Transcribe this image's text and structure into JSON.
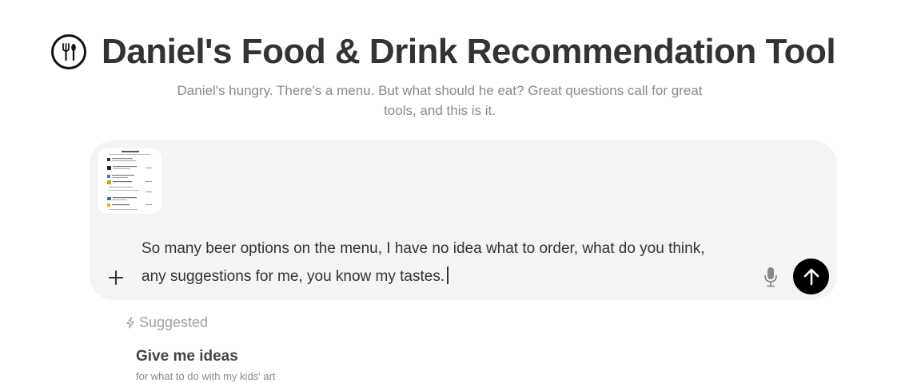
{
  "header": {
    "logo_icon": "fork-spoon-icon",
    "title": "Daniel's Food & Drink Recommendation Tool",
    "subtitle_line1": "Daniel's hungry. There's a menu. But what should he eat? Great questions call for great",
    "subtitle_line2": "tools, and this is it."
  },
  "composer": {
    "attachment_icon": "image-thumbnail",
    "prompt_line1": "So many beer options on the menu, I have no idea what to order, what do you think,",
    "prompt_line2": "any suggestions for me, you know my tastes.",
    "add_icon": "plus-icon",
    "mic_icon": "microphone-icon",
    "send_icon": "arrow-up-icon"
  },
  "suggestions": {
    "label": "Suggested",
    "label_icon": "lightning-icon",
    "items": [
      {
        "title": "Give me ideas",
        "subtitle": "for what to do with my kids' art"
      }
    ]
  },
  "colors": {
    "composer_bg": "#f4f4f4",
    "send_button": "#000000",
    "title": "#333333",
    "muted": "#8a8a8a"
  }
}
